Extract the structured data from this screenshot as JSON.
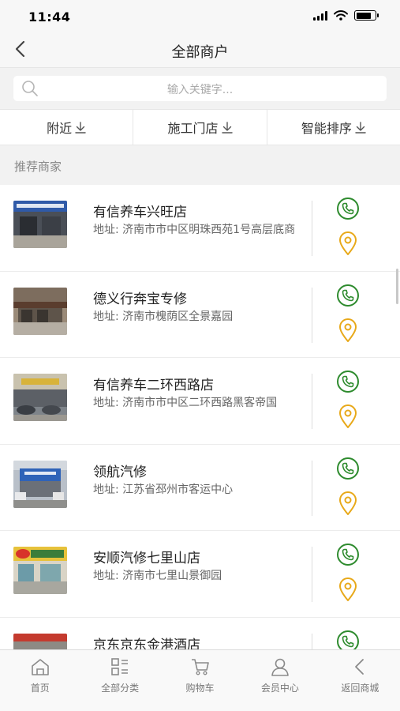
{
  "status_bar": {
    "time": "11:44",
    "battery_level": 0.8
  },
  "nav": {
    "title": "全部商户"
  },
  "search": {
    "placeholder": "输入关键字..."
  },
  "filters": [
    {
      "label": "附近"
    },
    {
      "label": "施工门店"
    },
    {
      "label": "智能排序"
    }
  ],
  "section": {
    "label": "推荐商家"
  },
  "merchants": [
    {
      "name": "有信养车兴旺店",
      "address": "地址: 济南市市中区明珠西苑1号高层底商"
    },
    {
      "name": "德义行奔宝专修",
      "address": "地址: 济南市槐荫区全景嘉园"
    },
    {
      "name": "有信养车二环西路店",
      "address": "地址: 济南市市中区二环西路黑客帝国"
    },
    {
      "name": "领航汽修",
      "address": "地址: 江苏省邳州市客运中心"
    },
    {
      "name": "安顺汽修七里山店",
      "address": "地址: 济南市七里山景御园"
    },
    {
      "name": "京东京东金港酒店",
      "address": ""
    }
  ],
  "colors": {
    "phone": "#2e8b2e",
    "location": "#e8a91a",
    "tab_icon": "#8a8a8a"
  },
  "tabs": [
    {
      "label": "首页",
      "icon": "home-icon"
    },
    {
      "label": "全部分类",
      "icon": "category-icon"
    },
    {
      "label": "购物车",
      "icon": "cart-icon"
    },
    {
      "label": "会员中心",
      "icon": "user-icon"
    },
    {
      "label": "返回商城",
      "icon": "back-arrow-icon"
    }
  ]
}
